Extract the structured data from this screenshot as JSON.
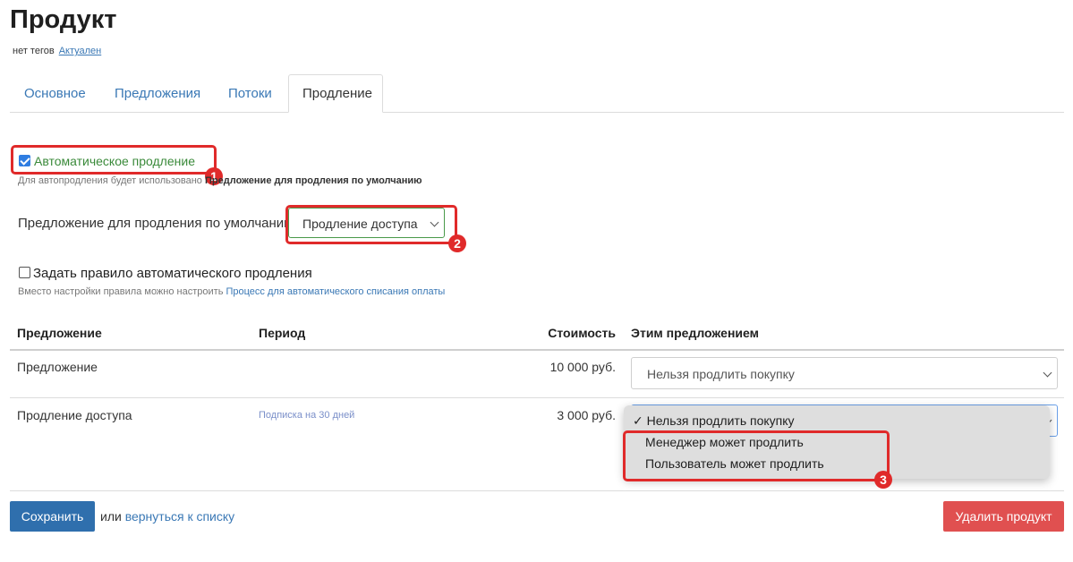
{
  "page": {
    "title": "Продукт",
    "tags_text": "нет тегов",
    "status_link": "Актуален"
  },
  "tabs": [
    {
      "label": "Основное"
    },
    {
      "label": "Предложения"
    },
    {
      "label": "Потоки"
    },
    {
      "label": "Продление",
      "active": true
    }
  ],
  "auto_renewal": {
    "checked": true,
    "label": "Автоматическое продление",
    "hint_prefix": "Для автопродления будет использовано",
    "hint_bold": "Предложение для продления по умолчанию",
    "default_offer_label": "Предложение для продления по умолчанию:",
    "default_offer_value": "Продление доступа"
  },
  "rule": {
    "checked": false,
    "label": "Задать правило автоматического продления",
    "hint_prefix": "Вместо настройки правила можно настроить",
    "hint_link": "Процесс для автоматического списания оплаты"
  },
  "table": {
    "headers": [
      "Предложение",
      "Период",
      "Стоимость",
      "Этим предложением"
    ],
    "rows": [
      {
        "offer": "Предложение",
        "period": "",
        "price": "10 000 руб.",
        "action": "Нельзя продлить покупку"
      },
      {
        "offer": "Продление доступа",
        "period": "Подписка на 30 дней",
        "price": "3 000 руб.",
        "action": "Нельзя продлить покупку"
      }
    ]
  },
  "dropdown": {
    "options": [
      "✓ Нельзя продлить покупку",
      "Менеджер может продлить",
      "Пользователь может продлить"
    ]
  },
  "footer": {
    "save_label": "Сохранить",
    "or_text": "или",
    "back_link": "вернуться к списку",
    "delete_label": "Удалить продукт"
  },
  "annotations": [
    "1",
    "2",
    "3"
  ],
  "colors": {
    "accent_red": "#e02a2a",
    "link_blue": "#3a78b5",
    "save_blue": "#2f6fad",
    "delete_red": "#e05050",
    "green_text": "#3a8a3a"
  }
}
